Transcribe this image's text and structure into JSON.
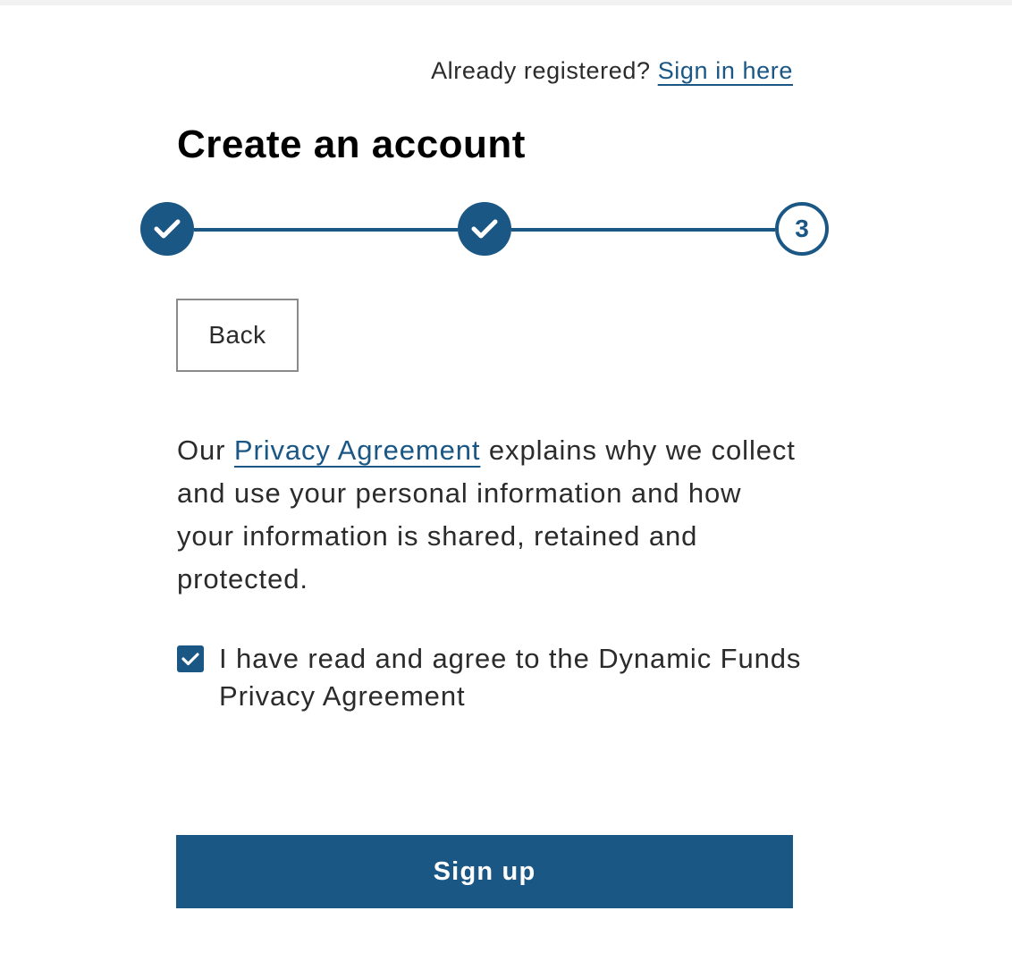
{
  "header": {
    "already_registered": "Already registered?",
    "sign_in_link": "Sign in here"
  },
  "title": "Create an account",
  "stepper": {
    "steps": [
      {
        "state": "complete",
        "icon": "check-icon"
      },
      {
        "state": "complete",
        "icon": "check-icon"
      },
      {
        "state": "current",
        "label": "3"
      }
    ]
  },
  "back_label": "Back",
  "privacy": {
    "prefix": "Our",
    "link": "Privacy Agreement",
    "suffix": "explains why we collect and use your personal information and how your information is shared, retained and protected."
  },
  "agreement": {
    "checked": true,
    "label": "I have read and agree to the Dynamic Funds Privacy Agreement"
  },
  "signup_label": "Sign up",
  "colors": {
    "accent": "#1a5785",
    "text": "#2b2b2b",
    "title": "#000000",
    "button_border": "#8a8a8a"
  }
}
